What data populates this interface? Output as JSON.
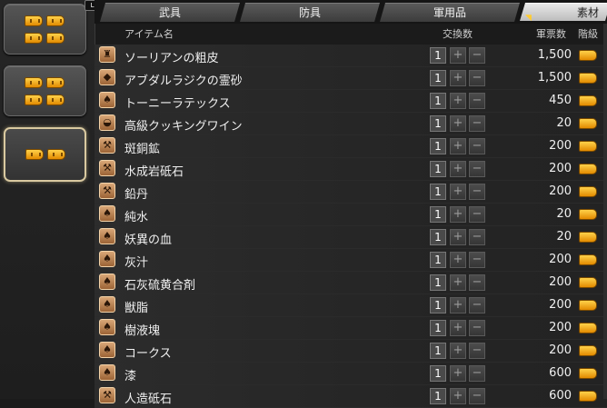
{
  "lb_badge": "LB",
  "tabs": [
    {
      "label": "武具"
    },
    {
      "label": "防具"
    },
    {
      "label": "軍用品"
    },
    {
      "label": "素材"
    }
  ],
  "header": {
    "name": "アイテム名",
    "exchange": "交換数",
    "cost": "軍票数",
    "grade": "階級"
  },
  "colors": {
    "seal_gold": "#ffc21a",
    "active_tab": "#e0e0e0",
    "row_bg": "#2a2a2a"
  },
  "items": [
    {
      "name": "ソーリアンの粗皮",
      "qty": "1",
      "cost": "1,500",
      "icon": "hide-icon"
    },
    {
      "name": "アブダルラジクの霊砂",
      "qty": "1",
      "cost": "1,500",
      "icon": "sand-icon"
    },
    {
      "name": "トーニーラテックス",
      "qty": "1",
      "cost": "450",
      "icon": "latex-icon"
    },
    {
      "name": "高級クッキングワイン",
      "qty": "1",
      "cost": "20",
      "icon": "wine-icon"
    },
    {
      "name": "斑銅鉱",
      "qty": "1",
      "cost": "200",
      "icon": "ore-icon"
    },
    {
      "name": "水成岩砥石",
      "qty": "1",
      "cost": "200",
      "icon": "whetstone-icon"
    },
    {
      "name": "鉛丹",
      "qty": "1",
      "cost": "200",
      "icon": "minium-icon"
    },
    {
      "name": "純水",
      "qty": "1",
      "cost": "20",
      "icon": "water-icon"
    },
    {
      "name": "妖異の血",
      "qty": "1",
      "cost": "20",
      "icon": "blood-icon"
    },
    {
      "name": "灰汁",
      "qty": "1",
      "cost": "200",
      "icon": "lye-icon"
    },
    {
      "name": "石灰硫黄合剤",
      "qty": "1",
      "cost": "200",
      "icon": "sulfur-icon"
    },
    {
      "name": "獣脂",
      "qty": "1",
      "cost": "200",
      "icon": "tallow-icon"
    },
    {
      "name": "樹液塊",
      "qty": "1",
      "cost": "200",
      "icon": "sap-icon"
    },
    {
      "name": "コークス",
      "qty": "1",
      "cost": "200",
      "icon": "coke-icon"
    },
    {
      "name": "漆",
      "qty": "1",
      "cost": "600",
      "icon": "lacquer-icon"
    },
    {
      "name": "人造砥石",
      "qty": "1",
      "cost": "600",
      "icon": "synthetic-whetstone-icon"
    }
  ]
}
